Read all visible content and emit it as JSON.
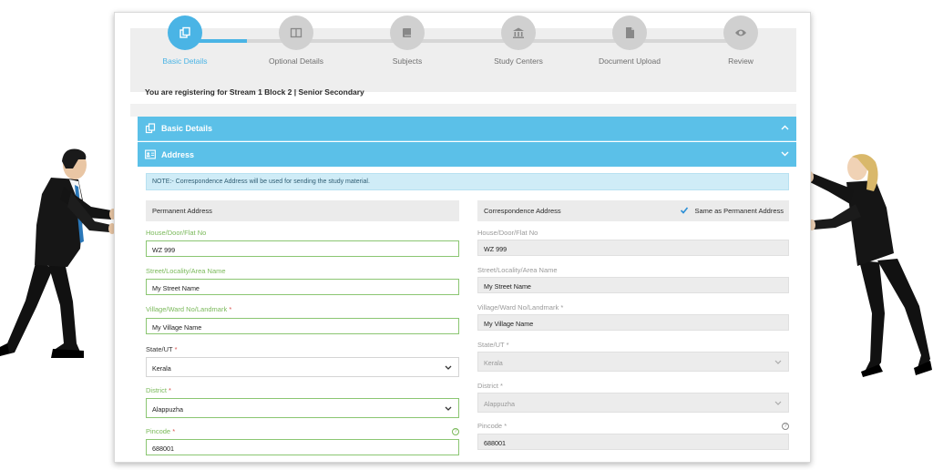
{
  "stepper": {
    "steps": [
      {
        "label": "Basic Details",
        "icon": "copy-icon",
        "active": true
      },
      {
        "label": "Optional Details",
        "icon": "columns-icon",
        "active": false
      },
      {
        "label": "Subjects",
        "icon": "book-icon",
        "active": false
      },
      {
        "label": "Study Centers",
        "icon": "institution-icon",
        "active": false
      },
      {
        "label": "Document Upload",
        "icon": "file-icon",
        "active": false
      },
      {
        "label": "Review",
        "icon": "eye-icon",
        "active": false
      }
    ]
  },
  "registration_text": "You are registering for Stream 1 Block 2 | Senior Secondary",
  "accordions": {
    "basic": "Basic Details",
    "address": "Address"
  },
  "note": "NOTE:- Correspondence Address will be used for sending the study material.",
  "permanent": {
    "heading": "Permanent Address",
    "house_label": "House/Door/Flat No",
    "house_value": "WZ 999",
    "street_label": "Street/Locality/Area Name",
    "street_value": "My Street Name",
    "village_label": "Village/Ward No/Landmark",
    "village_value": "My Village Name",
    "state_label": "State/UT",
    "state_value": "Kerala",
    "district_label": "District",
    "district_value": "Alappuzha",
    "pincode_label": "Pincode",
    "pincode_value": "688001"
  },
  "correspondence": {
    "heading": "Correspondence Address",
    "same_label": "Same as Permanent Address",
    "same_checked": true,
    "house_label": "House/Door/Flat No",
    "house_value": "WZ 999",
    "street_label": "Street/Locality/Area Name",
    "street_value": "My Street Name",
    "village_label": "Village/Ward No/Landmark",
    "village_value": "My Village Name",
    "state_label": "State/UT",
    "state_value": "Kerala",
    "district_label": "District",
    "district_value": "Alappuzha",
    "pincode_label": "Pincode",
    "pincode_value": "688001"
  },
  "required_marker": "*",
  "help_glyph": "?",
  "colors": {
    "accent": "#4ab4e5",
    "accordion": "#5bc0e8",
    "valid_green": "#7ab95a",
    "required_red": "#d9534f"
  }
}
